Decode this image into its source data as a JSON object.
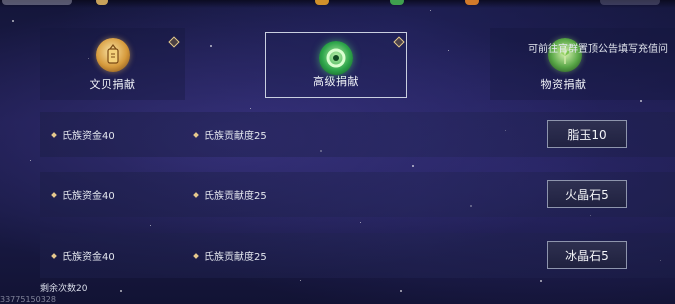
{
  "tabs": [
    {
      "label": "文贝捐献",
      "icon": "coin-pouch-icon",
      "selected": false
    },
    {
      "label": "高级捐献",
      "icon": "jade-ring-icon",
      "selected": true
    },
    {
      "label": "物资捐献",
      "icon": "herb-plant-icon",
      "selected": false
    }
  ],
  "notice": "可前往官群置顶公告填写充值问",
  "rows": [
    {
      "reward_a": "氏族资金40",
      "reward_b": "氏族贡献度25",
      "button": "脂玉10"
    },
    {
      "reward_a": "氏族资金40",
      "reward_b": "氏族贡献度25",
      "button": "火晶石5"
    },
    {
      "reward_a": "氏族资金40",
      "reward_b": "氏族贡献度25",
      "button": "冰晶石5"
    }
  ],
  "remaining": "剩余次数20",
  "user_id": "33775150328",
  "colors": {
    "background": "#1d1c4d",
    "accent_gold": "#e6c98d",
    "selected_border": "#c9cfe0"
  }
}
